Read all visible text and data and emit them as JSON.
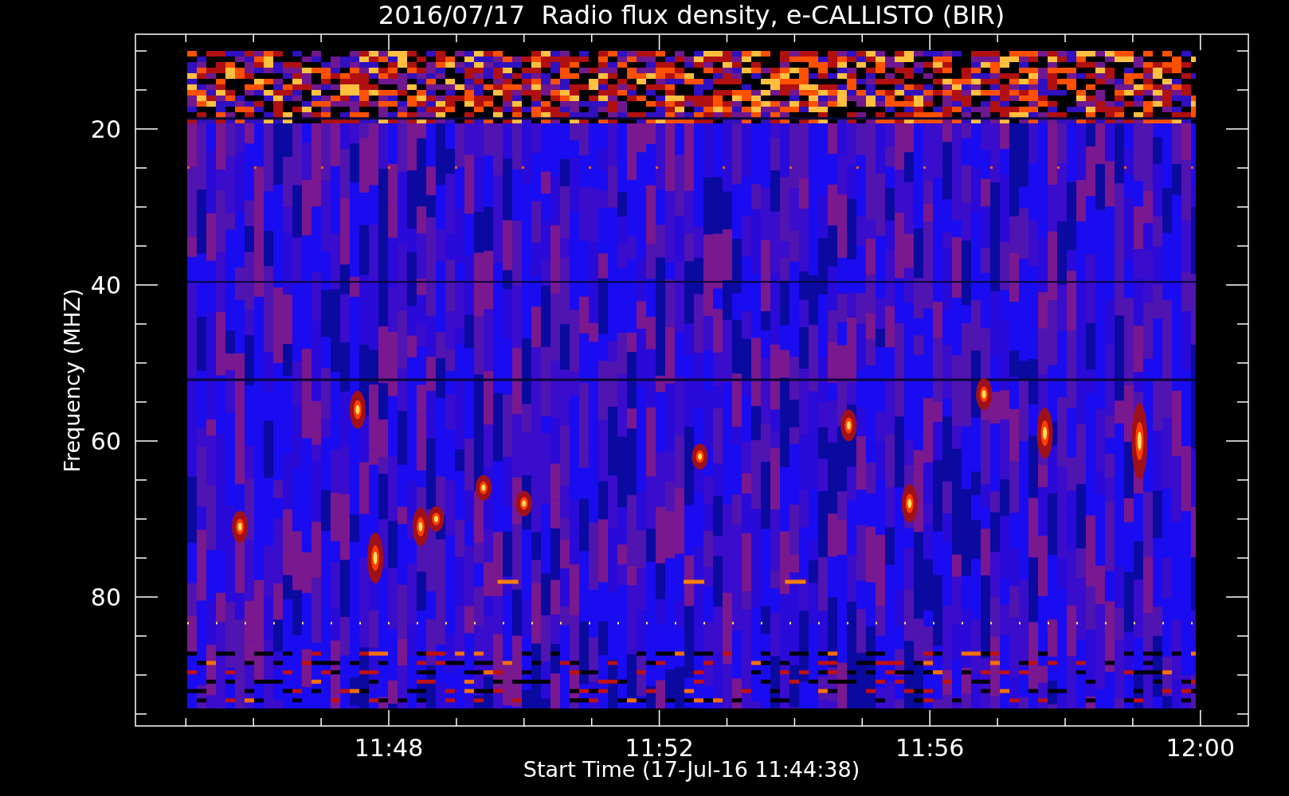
{
  "title": "2016/07/17  Radio flux density, e-CALLISTO (BIR)",
  "y_axis": {
    "label": "Frequency (MHZ)",
    "ticks": [
      "20",
      "40",
      "60",
      "80"
    ]
  },
  "x_axis": {
    "label": "Start Time (17-Jul-16 11:44:38)",
    "ticks": [
      "11:48",
      "11:52",
      "11:56",
      "12:00"
    ]
  }
}
